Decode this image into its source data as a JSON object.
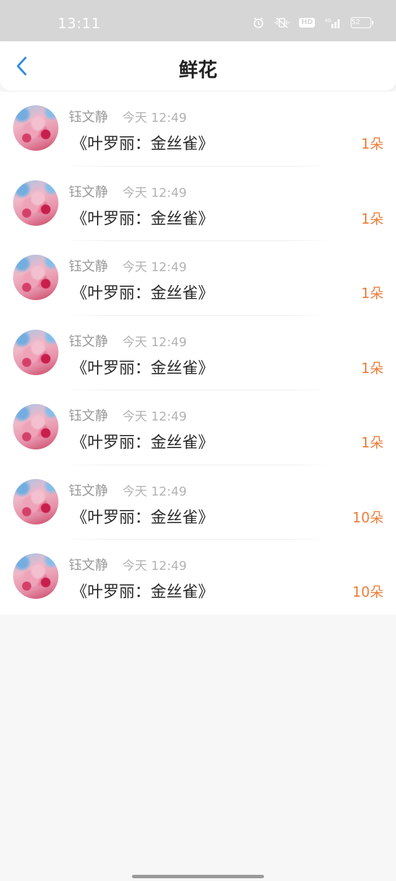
{
  "status_bar": {
    "time": "13:11",
    "hd_label": "HD",
    "network_label": "4G",
    "battery_level": "52"
  },
  "header": {
    "title": "鲜花"
  },
  "colors": {
    "accent_blue": "#2f8be0",
    "count_orange": "#ee7d3a"
  },
  "records": [
    {
      "user": "钰文静",
      "time": "今天 12:49",
      "gift": "《叶罗丽：金丝雀》",
      "count": "1朵"
    },
    {
      "user": "钰文静",
      "time": "今天 12:49",
      "gift": "《叶罗丽：金丝雀》",
      "count": "1朵"
    },
    {
      "user": "钰文静",
      "time": "今天 12:49",
      "gift": "《叶罗丽：金丝雀》",
      "count": "1朵"
    },
    {
      "user": "钰文静",
      "time": "今天 12:49",
      "gift": "《叶罗丽：金丝雀》",
      "count": "1朵"
    },
    {
      "user": "钰文静",
      "time": "今天 12:49",
      "gift": "《叶罗丽：金丝雀》",
      "count": "1朵"
    },
    {
      "user": "钰文静",
      "time": "今天 12:49",
      "gift": "《叶罗丽：金丝雀》",
      "count": "10朵"
    },
    {
      "user": "钰文静",
      "time": "今天 12:49",
      "gift": "《叶罗丽：金丝雀》",
      "count": "10朵"
    }
  ]
}
